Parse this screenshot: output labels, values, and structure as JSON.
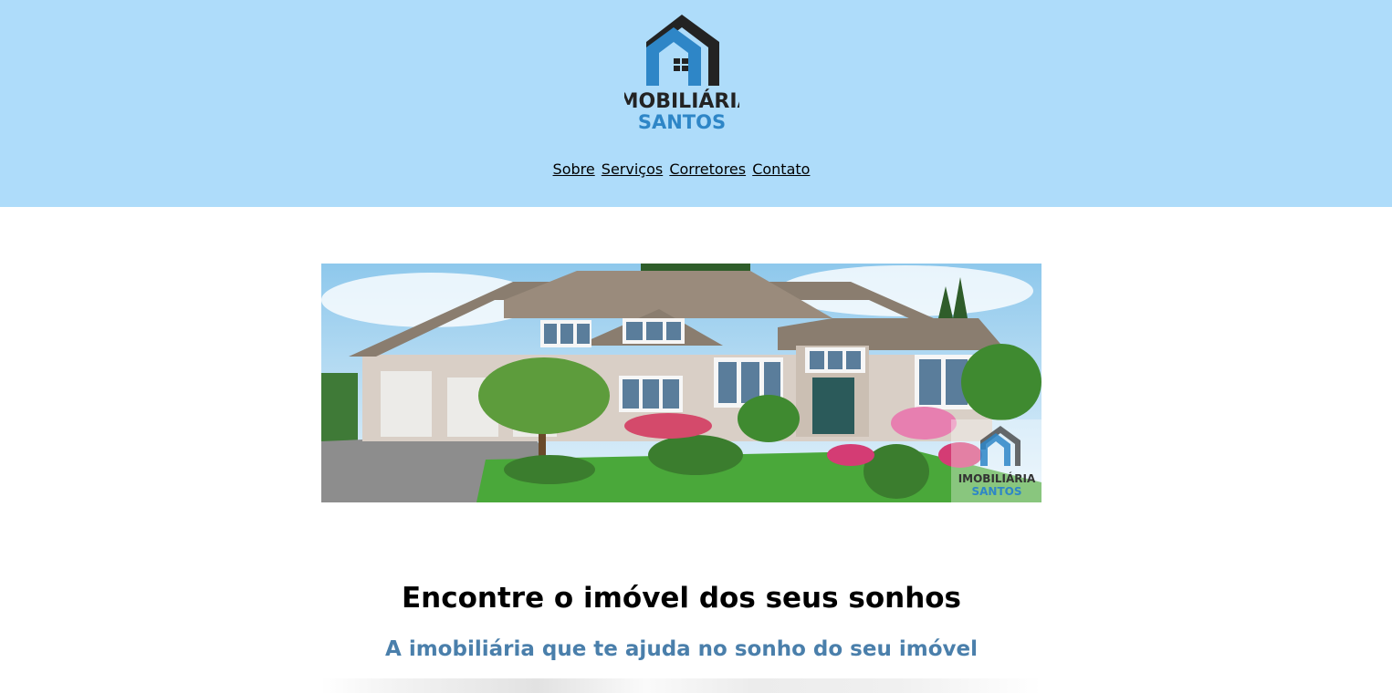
{
  "header": {
    "logo": {
      "line1": "IMOBILIÁRIA",
      "line2": "SANTOS",
      "icon": "house-icon"
    },
    "background_color": "#aedcfa"
  },
  "nav": {
    "items": [
      {
        "label": "Sobre"
      },
      {
        "label": "Serviços"
      },
      {
        "label": "Corretores"
      },
      {
        "label": "Contato"
      }
    ]
  },
  "banner": {
    "watermark": {
      "line1": "IMOBILIÁRIA",
      "line2": "SANTOS"
    }
  },
  "main": {
    "headline": "Encontre o imóvel dos seus sonhos",
    "subheadline": "A imobiliária que te ajuda no sonho do seu imóvel",
    "subheadline_color": "#4a7fab"
  }
}
